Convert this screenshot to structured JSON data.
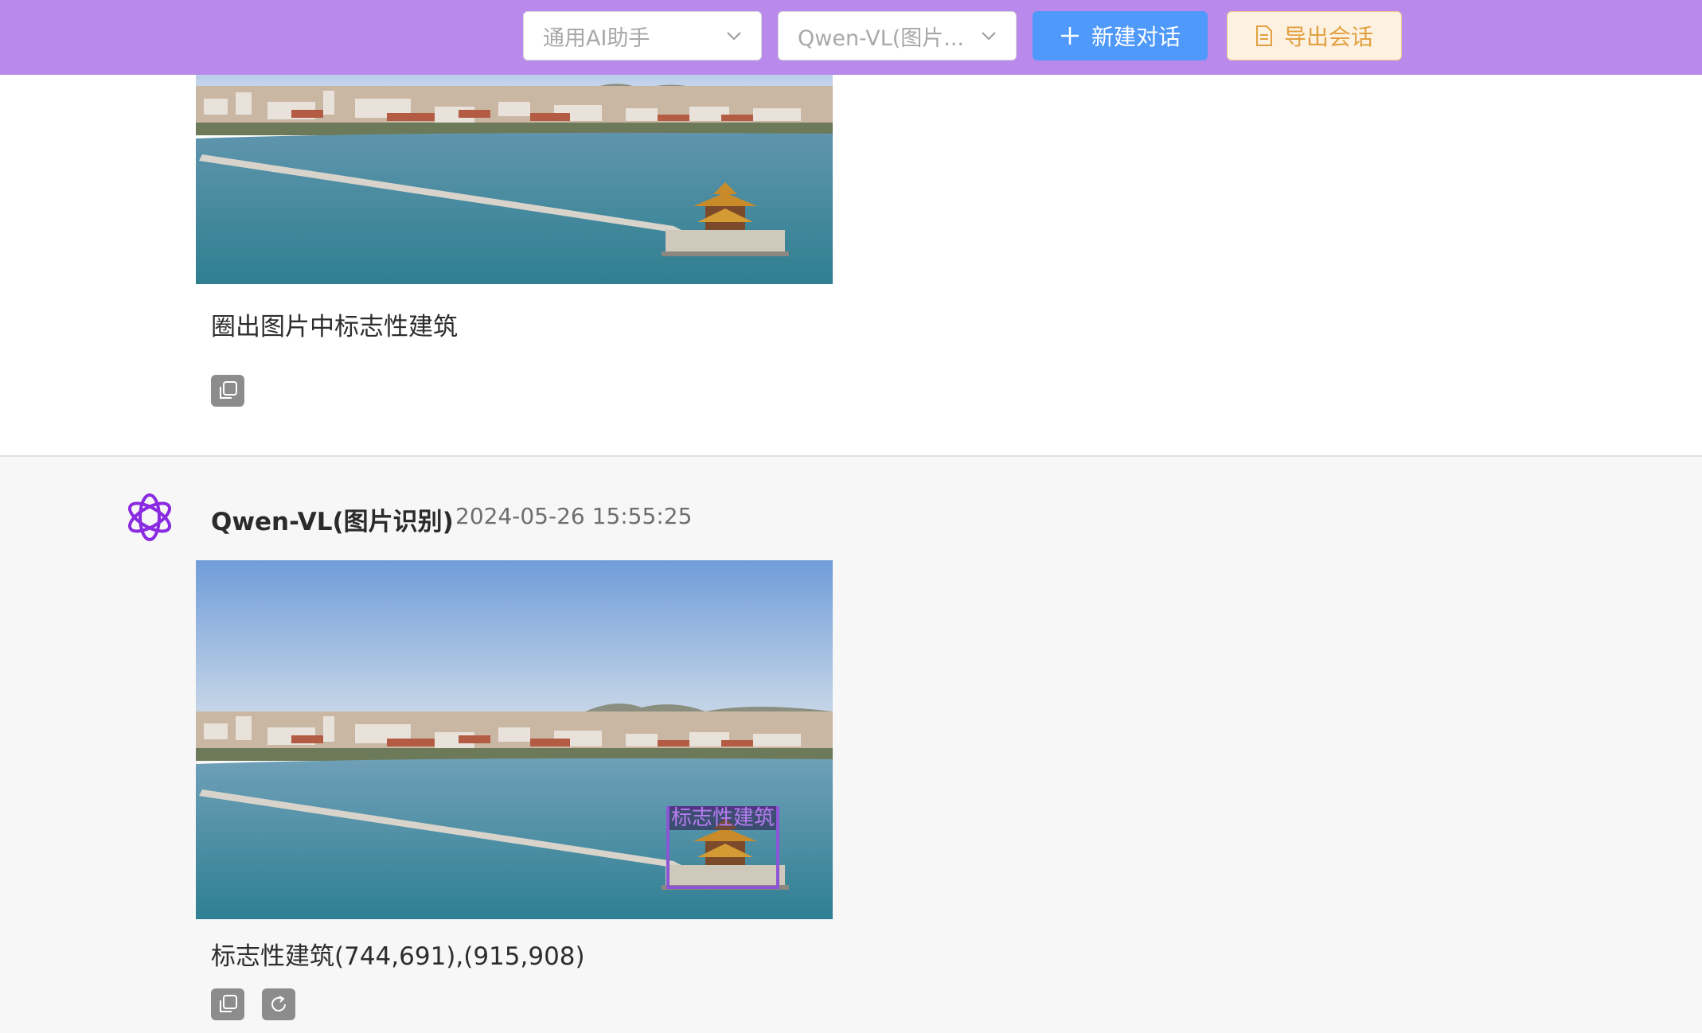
{
  "header": {
    "assistant_select": "通用AI助手",
    "model_select": "Qwen-VL(图片...",
    "new_chat_label": "新建对话",
    "export_label": "导出会话"
  },
  "user_message": {
    "text": "圈出图片中标志性建筑"
  },
  "ai_message": {
    "model_name": "Qwen-VL(图片识别)",
    "timestamp": "2024-05-26 15:55:25",
    "bbox_label": "标志性建筑",
    "text": "标志性建筑(744,691),(915,908)"
  },
  "colors": {
    "topbar": "#b98aec",
    "primary": "#4f99fa",
    "warn": "#e2a040",
    "bbox": "#8b55d6"
  },
  "icons": [
    "chevron-down-icon",
    "plus-icon",
    "document-icon",
    "copy-icon",
    "refresh-icon",
    "openai-logo-icon"
  ]
}
